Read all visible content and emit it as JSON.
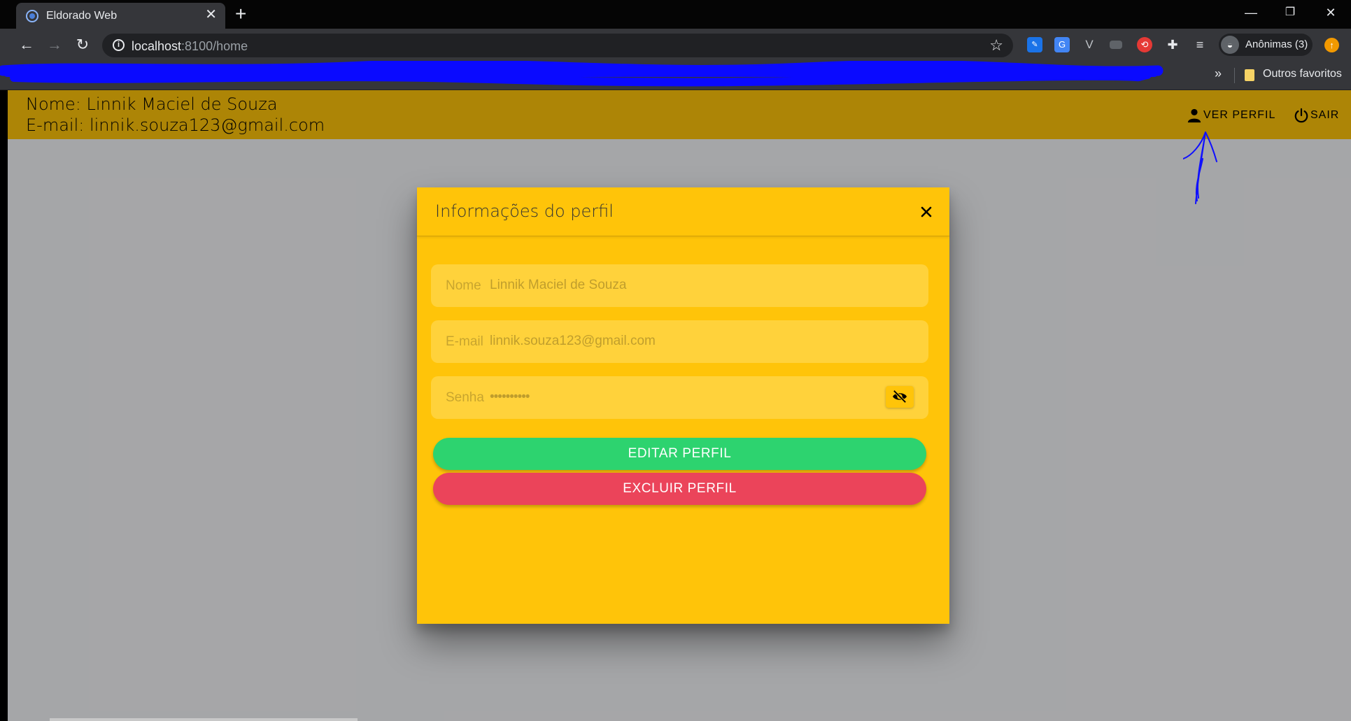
{
  "browser": {
    "tab_title": "Eldorado Web",
    "tab_close": "✕",
    "new_tab": "+",
    "window_controls": {
      "minimize": "—",
      "restore": "❐",
      "close": "✕"
    },
    "url_host": "localhost",
    "url_path": ":8100/home",
    "extension_icons": [
      "pencil-ext-icon",
      "translate-icon",
      "vue-devtools-icon",
      "video-ext-icon",
      "sync-ext-icon",
      "puzzle-icon",
      "media-queue-icon"
    ],
    "profile_label": "Anônimas (3)",
    "bookmarks_chevron": "»",
    "bookmarks_folder_label": "Outros favoritos"
  },
  "header": {
    "name_line": "Nome: Linnik Maciel de Souza",
    "email_line": "E-mail: linnik.souza123@gmail.com",
    "view_profile_label": "VER PERFIL",
    "logout_label": "SAIR",
    "background_color": "#ffc409"
  },
  "modal": {
    "title": "Informações do perfil",
    "fields": {
      "name": {
        "label": "Nome",
        "value": "Linnik Maciel de Souza"
      },
      "email": {
        "label": "E-mail",
        "value": "linnik.souza123@gmail.com"
      },
      "password": {
        "label": "Senha",
        "value": "••••••••••"
      }
    },
    "edit_button_label": "EDITAR PERFIL",
    "delete_button_label": "EXCLUIR PERFIL",
    "colors": {
      "edit": "#2dd36f",
      "delete": "#eb445a",
      "modal_bg": "#ffc409"
    }
  }
}
